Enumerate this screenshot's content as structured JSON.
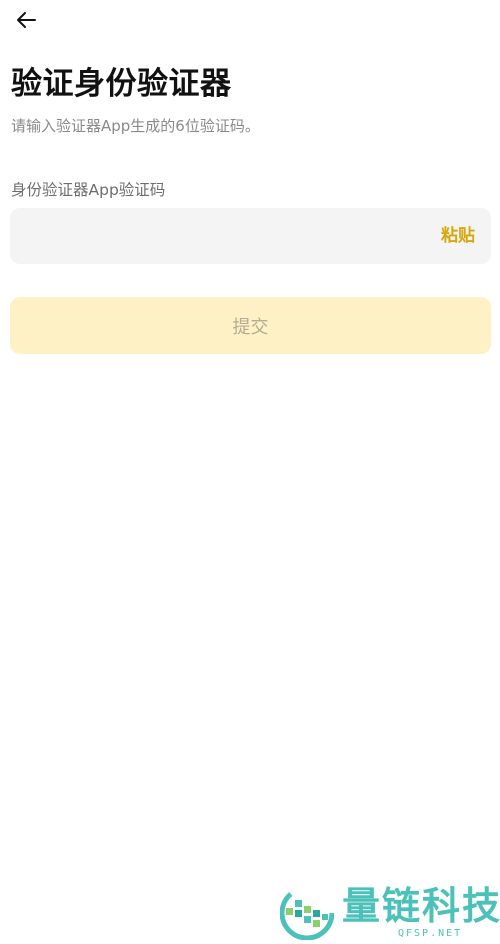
{
  "header": {
    "back_icon": "arrow-left-icon"
  },
  "page": {
    "title": "验证身份验证器",
    "subtitle": "请输入验证器App生成的6位验证码。"
  },
  "form": {
    "field_label": "身份验证器App验证码",
    "input_value": "",
    "input_placeholder": "",
    "paste_label": "粘贴",
    "submit_label": "提交"
  },
  "watermark": {
    "brand_text": "量链科技",
    "domain_text": "QFSP.NET"
  },
  "colors": {
    "accent": "#d8a70c",
    "submit_bg_disabled": "#fdf1c5",
    "input_bg": "#f4f4f4",
    "watermark": "#4cc1ba"
  }
}
